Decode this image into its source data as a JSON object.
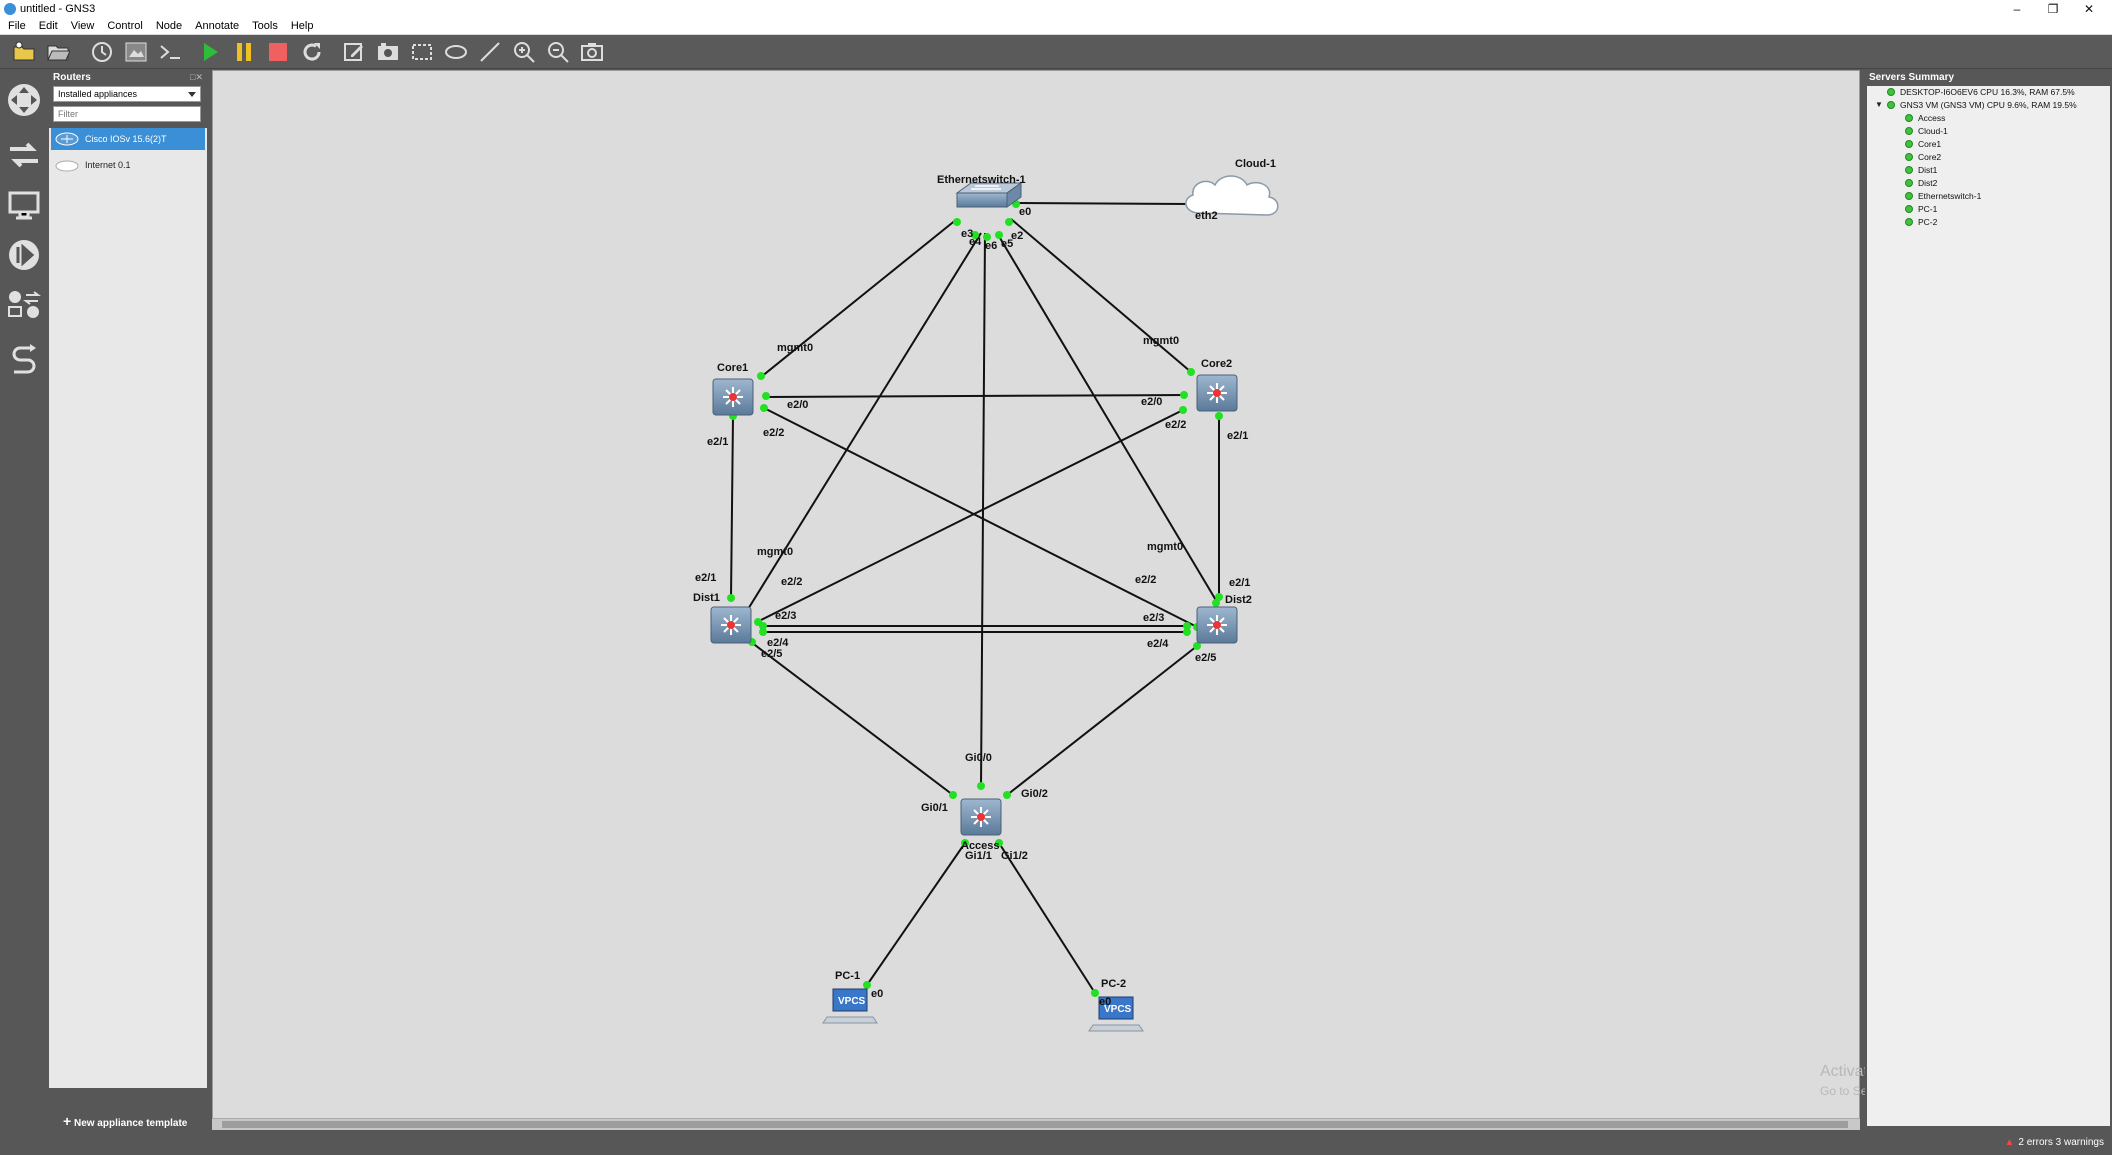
{
  "window": {
    "title": "untitled - GNS3"
  },
  "menu": [
    "File",
    "Edit",
    "View",
    "Control",
    "Node",
    "Annotate",
    "Tools",
    "Help"
  ],
  "toolbar_icons": [
    "new-project-icon",
    "open-project-icon",
    "snapshot-icon",
    "device-browser-icon",
    "console-all-icon",
    "start-all-icon",
    "suspend-all-icon",
    "stop-all-icon",
    "reload-all-icon",
    "add-note-icon",
    "insert-picture-icon",
    "draw-rectangle-icon",
    "draw-ellipse-icon",
    "draw-line-icon",
    "zoom-in-icon",
    "zoom-out-icon",
    "screenshot-icon"
  ],
  "routers_panel": {
    "header": "Routers",
    "select_value": "Installed appliances",
    "filter_placeholder": "Filter",
    "items": [
      {
        "label": "Cisco IOSv 15.6(2)T",
        "selected": true
      },
      {
        "label": "Internet 0.1",
        "selected": false
      }
    ],
    "new_template": "New appliance template"
  },
  "topology": {
    "nodes": {
      "esw": "Ethernetswitch-1",
      "cloud": "Cloud-1",
      "core1": "Core1",
      "core2": "Core2",
      "dist1": "Dist1",
      "dist2": "Dist2",
      "access": "Access",
      "pc1": "PC-1",
      "pc2": "PC-2"
    },
    "vpcs_label": "VPCS",
    "ports": {
      "esw_e0": "e0",
      "esw_e3": "e3",
      "esw_e4": "e4",
      "esw_e6": "e6",
      "esw_e5": "e5",
      "esw_e2": "e2",
      "cloud_eth2": "eth2",
      "c1_mgmt": "mgmt0",
      "c1_e20": "e2/0",
      "c1_e22": "e2/2",
      "c1_e21": "e2/1",
      "c2_mgmt": "mgmt0",
      "c2_e20": "e2/0",
      "c2_e22": "e2/2",
      "c2_e21": "e2/1",
      "d1_mgmt": "mgmt0",
      "d1_e21": "e2/1",
      "d1_e22": "e2/2",
      "d1_e23": "e2/3",
      "d1_e24": "e2/4",
      "d1_e25": "e2/5",
      "d2_mgmt": "mgmt0",
      "d2_e21": "e2/1",
      "d2_e22": "e2/2",
      "d2_e23": "e2/3",
      "d2_e24": "e2/4",
      "d2_e25": "e2/5",
      "a_gi00": "Gi0/0",
      "a_gi01": "Gi0/1",
      "a_gi02": "Gi0/2",
      "a_gi11": "Gi1/1",
      "a_gi12": "Gi1/2",
      "pc1_e0": "e0",
      "pc2_e0": "e0"
    }
  },
  "watermark": {
    "line1": "Activate Windows",
    "line2": "Go to Settings to activate Windows."
  },
  "servers_panel": {
    "header": "Servers Summary",
    "local": "DESKTOP-I6O6EV6 CPU 16.3%, RAM 67.5%",
    "vm": "GNS3 VM (GNS3 VM) CPU 9.6%, RAM 19.5%",
    "nodes": [
      "Access",
      "Cloud-1",
      "Core1",
      "Core2",
      "Dist1",
      "Dist2",
      "Ethernetswitch-1",
      "PC-1",
      "PC-2"
    ]
  },
  "status": {
    "text": "2 errors 3 warnings"
  },
  "colors": {
    "port_up": "#22e022",
    "selection": "#3b8fd6",
    "canvas": "#dcdcdc"
  }
}
